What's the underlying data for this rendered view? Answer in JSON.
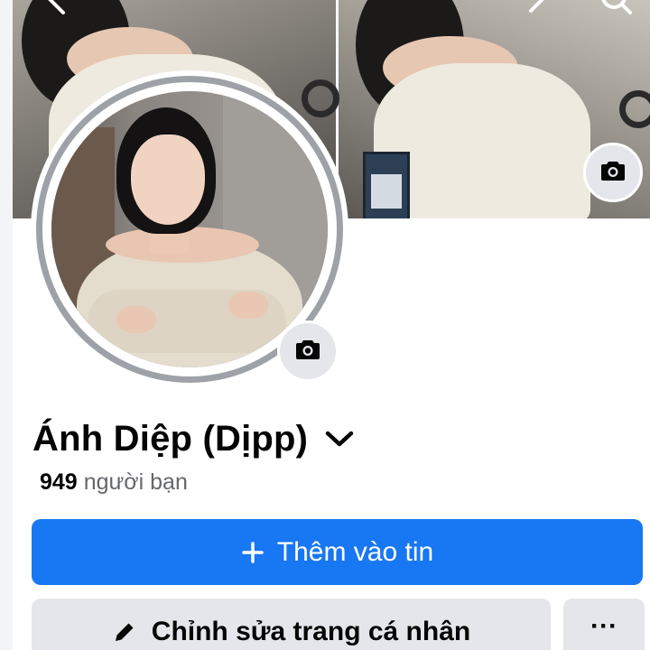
{
  "profile": {
    "name": "Ánh Diệp (Dịpp)",
    "friends_count": "949",
    "friends_label": "người bạn"
  },
  "actions": {
    "add_story_label": "Thêm vào tin",
    "edit_profile_label": "Chỉnh sửa trang cá nhân",
    "more_label": "···"
  },
  "icons": {
    "cover_camera": "camera-icon",
    "avatar_camera": "camera-icon",
    "name_dropdown": "chevron-down-icon",
    "add_story": "plus-icon",
    "edit_profile": "pencil-icon",
    "more": "more-icon",
    "back": "back-icon",
    "edit": "edit-icon",
    "search": "search-icon"
  },
  "colors": {
    "primary_button": "#1877f2",
    "secondary_button": "#e4e6eb",
    "text_primary": "#050505",
    "text_secondary": "#65676b"
  }
}
